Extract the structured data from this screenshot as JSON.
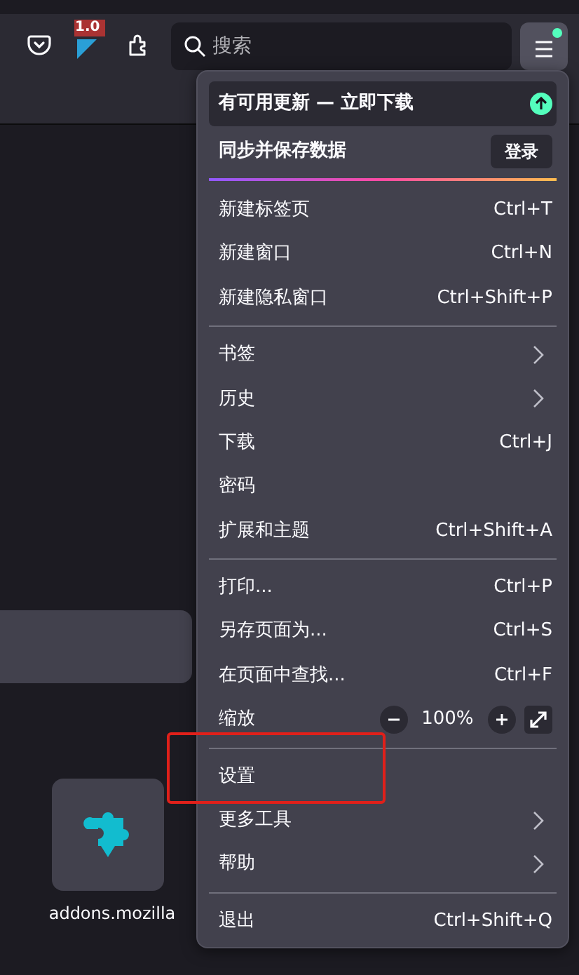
{
  "toolbar": {
    "badge": "1.0",
    "search": {
      "placeholder": "搜索"
    },
    "menu_button": {
      "notification": true
    }
  },
  "content": {
    "tiles": [
      {
        "label": "addons.mozilla"
      }
    ]
  },
  "menu": {
    "items": [
      {
        "kind": "update",
        "label": "有可用更新 — 立即下载"
      },
      {
        "kind": "sync",
        "label": "同步并保存数据",
        "button": "登录"
      },
      {
        "kind": "accent-separator"
      },
      {
        "kind": "item",
        "label": "新建标签页",
        "shortcut": "Ctrl+T"
      },
      {
        "kind": "item",
        "label": "新建窗口",
        "shortcut": "Ctrl+N"
      },
      {
        "kind": "item",
        "label": "新建隐私窗口",
        "shortcut": "Ctrl+Shift+P"
      },
      {
        "kind": "separator"
      },
      {
        "kind": "submenu",
        "label": "书签"
      },
      {
        "kind": "submenu",
        "label": "历史"
      },
      {
        "kind": "item",
        "label": "下载",
        "shortcut": "Ctrl+J"
      },
      {
        "kind": "item",
        "label": "密码"
      },
      {
        "kind": "item",
        "label": "扩展和主题",
        "shortcut": "Ctrl+Shift+A"
      },
      {
        "kind": "separator"
      },
      {
        "kind": "item",
        "label": "打印...",
        "shortcut": "Ctrl+P"
      },
      {
        "kind": "item",
        "label": "另存页面为...",
        "shortcut": "Ctrl+S"
      },
      {
        "kind": "item",
        "label": "在页面中查找...",
        "shortcut": "Ctrl+F"
      },
      {
        "kind": "zoom",
        "label": "缩放",
        "value": "100%"
      },
      {
        "kind": "separator"
      },
      {
        "kind": "item",
        "label": "设置",
        "highlighted": true
      },
      {
        "kind": "submenu",
        "label": "更多工具"
      },
      {
        "kind": "submenu",
        "label": "帮助"
      },
      {
        "kind": "separator"
      },
      {
        "kind": "item",
        "label": "退出",
        "shortcut": "Ctrl+Shift+Q"
      }
    ]
  }
}
